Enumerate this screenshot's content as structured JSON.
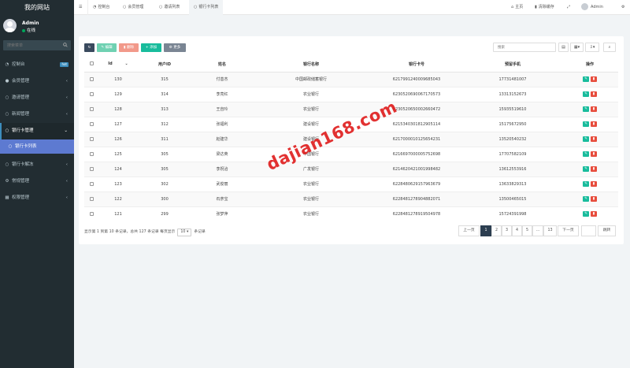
{
  "site": {
    "title": "我的网站"
  },
  "user": {
    "name": "Admin",
    "status": "在线"
  },
  "sidebar": {
    "search_placeholder": "搜索菜单",
    "items": [
      {
        "label": "控制台",
        "icon": "dashboard-icon",
        "badge": "hot"
      },
      {
        "label": "会员管理",
        "icon": "user-icon"
      },
      {
        "label": "邀请管理",
        "icon": "circle-icon"
      },
      {
        "label": "新闻管理",
        "icon": "circle-icon"
      },
      {
        "label": "银行卡管理",
        "icon": "circle-icon"
      },
      {
        "label": "银行卡列表",
        "icon": "circle-icon"
      },
      {
        "label": "银行卡解冻",
        "icon": "circle-icon"
      },
      {
        "label": "常规管理",
        "icon": "gear-icon"
      },
      {
        "label": "权限管理",
        "icon": "group-icon"
      }
    ]
  },
  "topbar": {
    "tabs": [
      "控制台",
      "会员管理",
      "邀请列表",
      "银行卡列表"
    ],
    "home": "主页",
    "clear_cache": "清除缓存",
    "admin": "Admin"
  },
  "toolbar": {
    "edit": "编辑",
    "delete": "删除",
    "add": "添加",
    "more": "更多",
    "search_placeholder": "搜索"
  },
  "table": {
    "headers": [
      "Id",
      "用户ID",
      "姓名",
      "银行名称",
      "银行卡号",
      "预留手机",
      "操作"
    ],
    "rows": [
      [
        "130",
        "315",
        "付善杰",
        "中国邮政储蓄银行",
        "6217991240009685043",
        "17731481007"
      ],
      [
        "129",
        "314",
        "李亮红",
        "农业银行",
        "6230520690067170573",
        "13313152673"
      ],
      [
        "128",
        "313",
        "王自玲",
        "农业银行",
        "6230520650002660472",
        "15935519610"
      ],
      [
        "127",
        "312",
        "张福利",
        "建设银行",
        "6215340301812905114",
        "15175672950"
      ],
      [
        "126",
        "311",
        "赵建华",
        "建设银行",
        "6217000010125654231",
        "13520540232"
      ],
      [
        "125",
        "305",
        "梁达英",
        "中国银行",
        "6216697000005752698",
        "17707582109"
      ],
      [
        "124",
        "305",
        "李祝洽",
        "广发银行",
        "6214620421001998482",
        "13612553916"
      ],
      [
        "123",
        "302",
        "武俊丽",
        "农业银行",
        "6228480629157963679",
        "13633829313"
      ],
      [
        "122",
        "300",
        "石彦宝",
        "农业银行",
        "6228481278904882071",
        "13500465015"
      ],
      [
        "121",
        "299",
        "张梦萍",
        "农业银行",
        "6228481278919504978",
        "15724391998"
      ]
    ]
  },
  "footer": {
    "summary_pre": "显示第 1 到第 10 条记录，总共 127 条记录 每页显示",
    "page_size": "10",
    "summary_post": "条记录",
    "prev": "上一页",
    "pages": [
      "1",
      "2",
      "3",
      "4",
      "5",
      "...",
      "13"
    ],
    "next": "下一页",
    "jump": "跳转"
  },
  "watermark": "dajian168.com",
  "colors": {
    "sidebar": "#222d32",
    "active_sub": "#5d7ad1",
    "add": "#18bc9c",
    "delete": "#e74c3c"
  }
}
